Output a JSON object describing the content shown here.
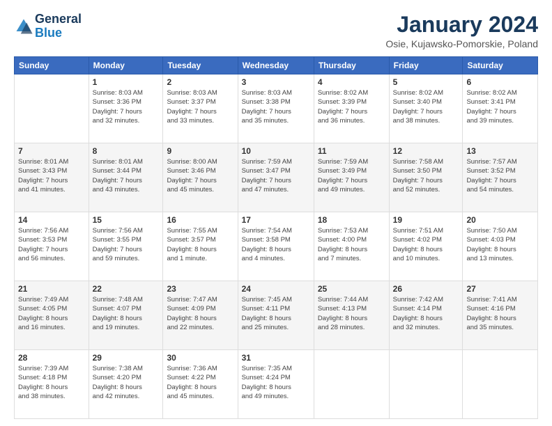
{
  "logo": {
    "line1": "General",
    "line2": "Blue"
  },
  "header": {
    "month_year": "January 2024",
    "location": "Osie, Kujawsko-Pomorskie, Poland"
  },
  "weekdays": [
    "Sunday",
    "Monday",
    "Tuesday",
    "Wednesday",
    "Thursday",
    "Friday",
    "Saturday"
  ],
  "weeks": [
    [
      {
        "day": "",
        "info": ""
      },
      {
        "day": "1",
        "info": "Sunrise: 8:03 AM\nSunset: 3:36 PM\nDaylight: 7 hours\nand 32 minutes."
      },
      {
        "day": "2",
        "info": "Sunrise: 8:03 AM\nSunset: 3:37 PM\nDaylight: 7 hours\nand 33 minutes."
      },
      {
        "day": "3",
        "info": "Sunrise: 8:03 AM\nSunset: 3:38 PM\nDaylight: 7 hours\nand 35 minutes."
      },
      {
        "day": "4",
        "info": "Sunrise: 8:02 AM\nSunset: 3:39 PM\nDaylight: 7 hours\nand 36 minutes."
      },
      {
        "day": "5",
        "info": "Sunrise: 8:02 AM\nSunset: 3:40 PM\nDaylight: 7 hours\nand 38 minutes."
      },
      {
        "day": "6",
        "info": "Sunrise: 8:02 AM\nSunset: 3:41 PM\nDaylight: 7 hours\nand 39 minutes."
      }
    ],
    [
      {
        "day": "7",
        "info": "Sunrise: 8:01 AM\nSunset: 3:43 PM\nDaylight: 7 hours\nand 41 minutes."
      },
      {
        "day": "8",
        "info": "Sunrise: 8:01 AM\nSunset: 3:44 PM\nDaylight: 7 hours\nand 43 minutes."
      },
      {
        "day": "9",
        "info": "Sunrise: 8:00 AM\nSunset: 3:46 PM\nDaylight: 7 hours\nand 45 minutes."
      },
      {
        "day": "10",
        "info": "Sunrise: 7:59 AM\nSunset: 3:47 PM\nDaylight: 7 hours\nand 47 minutes."
      },
      {
        "day": "11",
        "info": "Sunrise: 7:59 AM\nSunset: 3:49 PM\nDaylight: 7 hours\nand 49 minutes."
      },
      {
        "day": "12",
        "info": "Sunrise: 7:58 AM\nSunset: 3:50 PM\nDaylight: 7 hours\nand 52 minutes."
      },
      {
        "day": "13",
        "info": "Sunrise: 7:57 AM\nSunset: 3:52 PM\nDaylight: 7 hours\nand 54 minutes."
      }
    ],
    [
      {
        "day": "14",
        "info": "Sunrise: 7:56 AM\nSunset: 3:53 PM\nDaylight: 7 hours\nand 56 minutes."
      },
      {
        "day": "15",
        "info": "Sunrise: 7:56 AM\nSunset: 3:55 PM\nDaylight: 7 hours\nand 59 minutes."
      },
      {
        "day": "16",
        "info": "Sunrise: 7:55 AM\nSunset: 3:57 PM\nDaylight: 8 hours\nand 1 minute."
      },
      {
        "day": "17",
        "info": "Sunrise: 7:54 AM\nSunset: 3:58 PM\nDaylight: 8 hours\nand 4 minutes."
      },
      {
        "day": "18",
        "info": "Sunrise: 7:53 AM\nSunset: 4:00 PM\nDaylight: 8 hours\nand 7 minutes."
      },
      {
        "day": "19",
        "info": "Sunrise: 7:51 AM\nSunset: 4:02 PM\nDaylight: 8 hours\nand 10 minutes."
      },
      {
        "day": "20",
        "info": "Sunrise: 7:50 AM\nSunset: 4:03 PM\nDaylight: 8 hours\nand 13 minutes."
      }
    ],
    [
      {
        "day": "21",
        "info": "Sunrise: 7:49 AM\nSunset: 4:05 PM\nDaylight: 8 hours\nand 16 minutes."
      },
      {
        "day": "22",
        "info": "Sunrise: 7:48 AM\nSunset: 4:07 PM\nDaylight: 8 hours\nand 19 minutes."
      },
      {
        "day": "23",
        "info": "Sunrise: 7:47 AM\nSunset: 4:09 PM\nDaylight: 8 hours\nand 22 minutes."
      },
      {
        "day": "24",
        "info": "Sunrise: 7:45 AM\nSunset: 4:11 PM\nDaylight: 8 hours\nand 25 minutes."
      },
      {
        "day": "25",
        "info": "Sunrise: 7:44 AM\nSunset: 4:13 PM\nDaylight: 8 hours\nand 28 minutes."
      },
      {
        "day": "26",
        "info": "Sunrise: 7:42 AM\nSunset: 4:14 PM\nDaylight: 8 hours\nand 32 minutes."
      },
      {
        "day": "27",
        "info": "Sunrise: 7:41 AM\nSunset: 4:16 PM\nDaylight: 8 hours\nand 35 minutes."
      }
    ],
    [
      {
        "day": "28",
        "info": "Sunrise: 7:39 AM\nSunset: 4:18 PM\nDaylight: 8 hours\nand 38 minutes."
      },
      {
        "day": "29",
        "info": "Sunrise: 7:38 AM\nSunset: 4:20 PM\nDaylight: 8 hours\nand 42 minutes."
      },
      {
        "day": "30",
        "info": "Sunrise: 7:36 AM\nSunset: 4:22 PM\nDaylight: 8 hours\nand 45 minutes."
      },
      {
        "day": "31",
        "info": "Sunrise: 7:35 AM\nSunset: 4:24 PM\nDaylight: 8 hours\nand 49 minutes."
      },
      {
        "day": "",
        "info": ""
      },
      {
        "day": "",
        "info": ""
      },
      {
        "day": "",
        "info": ""
      }
    ]
  ]
}
